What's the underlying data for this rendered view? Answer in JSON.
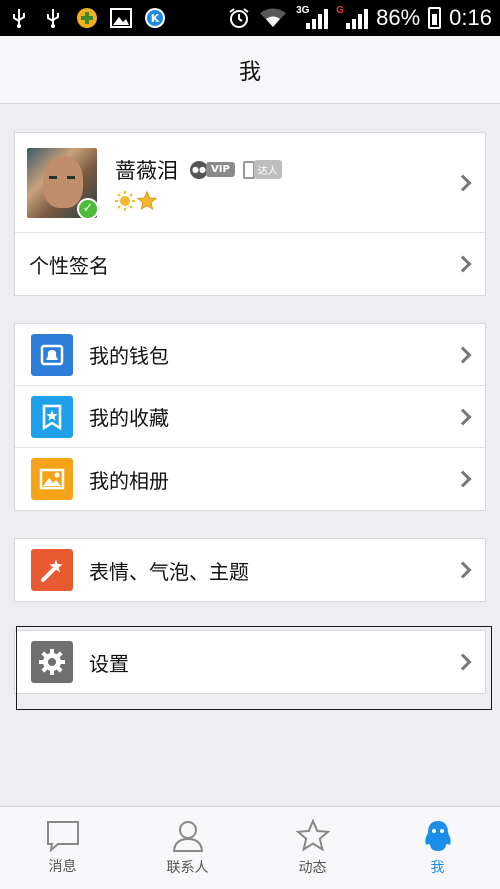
{
  "status_bar": {
    "battery": "86%",
    "time": "0:16",
    "net_3g": "3G",
    "net_g": "G",
    "icons": [
      "usb-icon",
      "usb-icon",
      "game-icon",
      "image-icon",
      "k-icon",
      "alarm-icon",
      "wifi-icon",
      "signal-icon",
      "battery-icon"
    ]
  },
  "header": {
    "title": "我"
  },
  "profile": {
    "name": "蔷薇泪",
    "vip_label": "VIP",
    "daren_label": "达人",
    "avatar_badge": "✓",
    "level_icons": [
      "sun-icon",
      "star-icon"
    ]
  },
  "signature": {
    "label": "个性签名"
  },
  "menu_group_1": [
    {
      "label": "我的钱包",
      "icon": "wallet-icon",
      "color": "#2d7ed8"
    },
    {
      "label": "我的收藏",
      "icon": "bookmark-star-icon",
      "color": "#1ea0ea"
    },
    {
      "label": "我的相册",
      "icon": "photo-icon",
      "color": "#f5a419"
    }
  ],
  "menu_group_2": [
    {
      "label": "表情、气泡、主题",
      "icon": "magic-wand-icon",
      "color": "#e85a32"
    }
  ],
  "menu_group_3": [
    {
      "label": "设置",
      "icon": "gear-icon",
      "color": "#6f6f6f"
    }
  ],
  "tabs": [
    {
      "label": "消息",
      "icon": "message-icon"
    },
    {
      "label": "联系人",
      "icon": "contacts-icon"
    },
    {
      "label": "动态",
      "icon": "star-outline-icon"
    },
    {
      "label": "我",
      "icon": "penguin-icon",
      "active": true
    }
  ],
  "colors": {
    "accent": "#1a8ee8",
    "background": "#eeeef2"
  }
}
